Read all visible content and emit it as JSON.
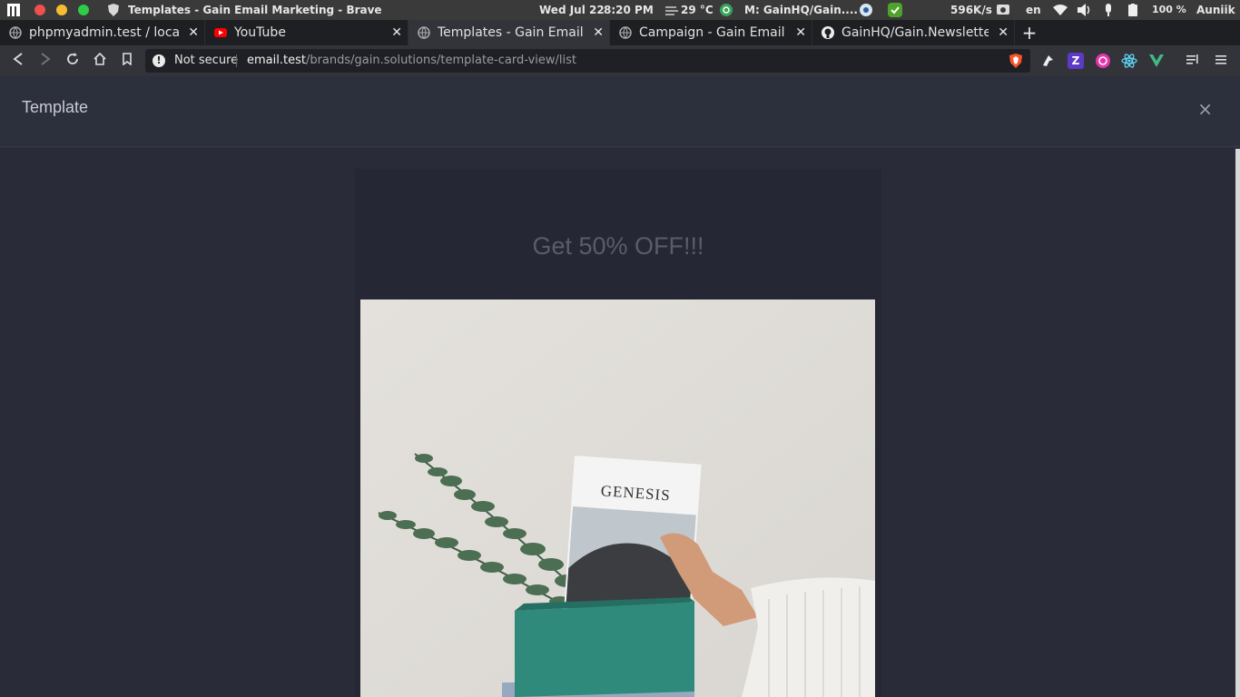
{
  "os": {
    "window_title": "Templates - Gain Email Marketing - Brave",
    "date": "Wed Jul 22",
    "time": "8:20 PM",
    "temperature": "29 °C",
    "mail": "M: GainHQ/Gain....",
    "network_speed": "596K/s",
    "language": "en",
    "battery": "100 %",
    "user": "Auniik"
  },
  "tabs": [
    {
      "label": "phpmyadmin.test / localhost",
      "icon": "globe-icon"
    },
    {
      "label": "YouTube",
      "icon": "youtube-icon"
    },
    {
      "label": "Templates - Gain Email Marketing",
      "icon": "globe-icon"
    },
    {
      "label": "Campaign - Gain Email Marketing",
      "icon": "globe-icon"
    },
    {
      "label": "GainHQ/Gain.Newsletter",
      "icon": "github-icon"
    }
  ],
  "new_tab": "+",
  "address_bar": {
    "security": "Not secure",
    "host": "email.test",
    "path": "/brands/gain.solutions/template-card-view/list"
  },
  "modal": {
    "title": "Template",
    "close": "×"
  },
  "template": {
    "heading": "Get 50% OFF!!!",
    "magazine_title": "GENESIS"
  },
  "colors": {
    "accent_brave": "#fb542b",
    "background": "#2c2f3c",
    "card": "#252734"
  }
}
